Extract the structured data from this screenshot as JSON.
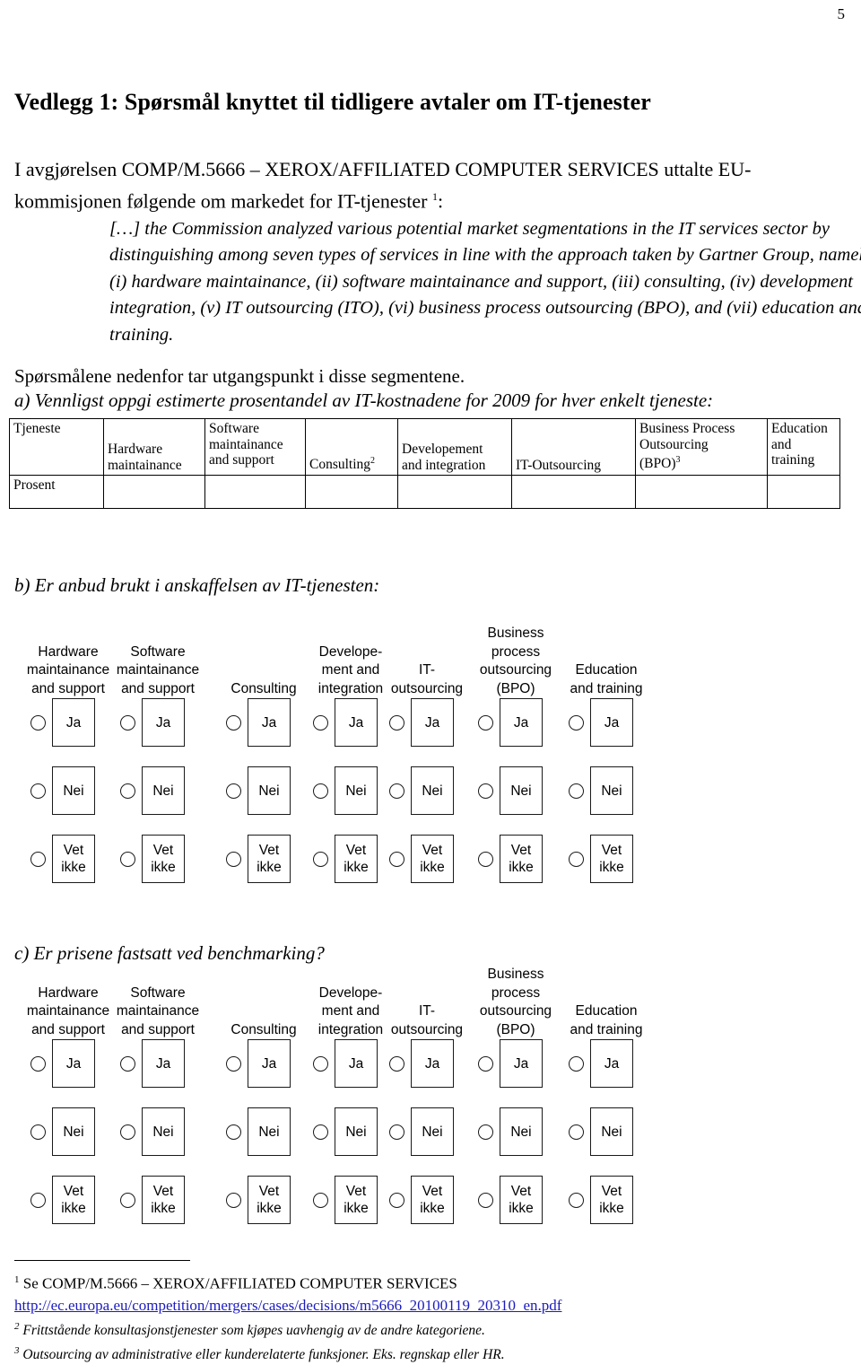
{
  "page": {
    "number": "5"
  },
  "document": {
    "title": "Vedlegg 1: Spørsmål knyttet til tidligere avtaler om IT-tjenester",
    "intro_before": "I avgjørelsen COMP/M.5666 – XEROX/AFFILIATED COMPUTER SERVICES uttalte EU-kommisjonen følgende om markedet for IT-tjenester ",
    "intro_footnote_marker": "1",
    "intro_after": ":",
    "quote": "[…] the Commission analyzed various potential market segmentations in the IT services sector by distinguishing among seven types of services in line with the approach taken by Gartner Group, namely: (i) hardware maintainance, (ii) software maintainance and support, (iii) consulting, (iv) development integration, (v) IT outsourcing (ITO), (vi) business process outsourcing (BPO), and (vii) education and training.",
    "lead": "Spørsmålene nedenfor tar utgangspunkt i disse segmentene."
  },
  "section_a": {
    "heading": "a) Vennligst oppgi estimerte prosentandel av IT-kostnadene for 2009 for hver enkelt tjeneste:",
    "row_label_header": "Tjeneste",
    "row_label_value": "Prosent",
    "columns": [
      {
        "line1": "Hardware",
        "line2": "maintainance",
        "sup": ""
      },
      {
        "line1": "Software",
        "line2": "maintainance",
        "line3": "and support",
        "sup": ""
      },
      {
        "line1": "Consulting",
        "line2": "",
        "sup": "2"
      },
      {
        "line1": "Developement",
        "line2": "and integration",
        "sup": ""
      },
      {
        "line1": "IT-Outsourcing",
        "line2": "",
        "sup": ""
      },
      {
        "line1": "Business Process",
        "line2": "Outsourcing",
        "line3": "(BPO)",
        "sup": "3"
      },
      {
        "line1": "Education",
        "line2": "and",
        "line3": "training",
        "sup": ""
      }
    ],
    "values": [
      "",
      "",
      "",
      "",
      "",
      "",
      ""
    ]
  },
  "section_b": {
    "heading": "b) Er anbud brukt i anskaffelsen av IT-tjenesten:",
    "columns": [
      "Hardware\nmaintainance\nand support",
      "Software\nmaintainance\nand support",
      "Consulting",
      "Develope-\nment and\nintegration",
      "IT-\noutsourcing",
      "Business\nprocess\noutsourcing\n(BPO)",
      "Education\nand training"
    ],
    "options": [
      {
        "id": "ja",
        "label": "Ja",
        "line2": ""
      },
      {
        "id": "nei",
        "label": "Nei",
        "line2": ""
      },
      {
        "id": "vet-ikke",
        "label": "Vet",
        "line2": "ikke"
      }
    ]
  },
  "section_c": {
    "heading": "c) Er prisene fastsatt ved benchmarking?",
    "columns": [
      "Hardware\nmaintainance\nand support",
      "Software\nmaintainance\nand support",
      "Consulting",
      "Develope-\nment and\nintegration",
      "IT-\noutsourcing",
      "Business\nprocess\noutsourcing\n(BPO)",
      "Education\nand training"
    ],
    "options": [
      {
        "id": "ja",
        "label": "Ja",
        "line2": ""
      },
      {
        "id": "nei",
        "label": "Nei",
        "line2": ""
      },
      {
        "id": "vet-ikke",
        "label": "Vet",
        "line2": "ikke"
      }
    ]
  },
  "footnotes": [
    {
      "marker": "1",
      "text": "Se COMP/M.5666 – XEROX/AFFILIATED COMPUTER SERVICES",
      "url": "http://ec.europa.eu/competition/mergers/cases/decisions/m5666_20100119_20310_en.pdf"
    },
    {
      "marker": "2",
      "text": "Frittstående konsultasjonstjenester som kjøpes uavhengig av de andre kategoriene."
    },
    {
      "marker": "3",
      "text": "Outsourcing av administrative eller kunderelaterte funksjoner. Eks. regnskap eller HR."
    }
  ],
  "layout": {
    "matrix_column_x": [
      24,
      124,
      242,
      339,
      424,
      523,
      624
    ],
    "table_col_widths": [
      105,
      113,
      112,
      103,
      127,
      138,
      147,
      81
    ]
  },
  "colors": {
    "link": "#1b1bc0",
    "ink": "#000000"
  }
}
